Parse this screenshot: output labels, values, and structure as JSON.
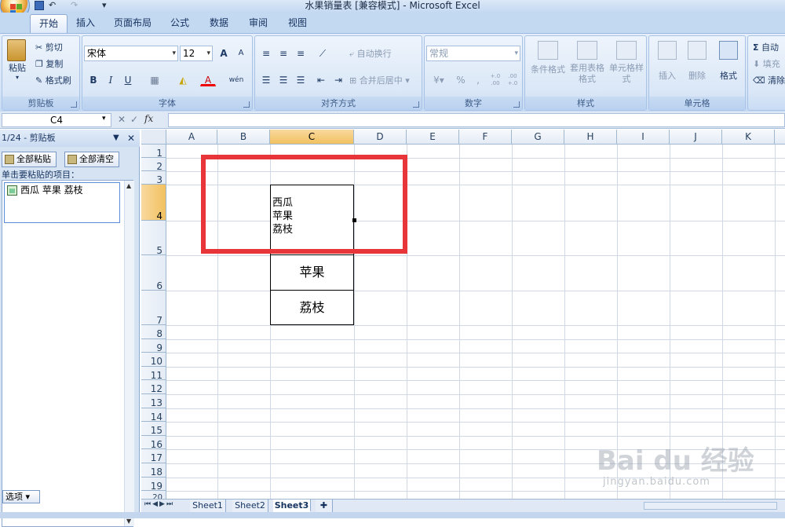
{
  "window": {
    "title": "水果销量表 [兼容模式] - Microsoft Excel"
  },
  "tabs": [
    "开始",
    "插入",
    "页面布局",
    "公式",
    "数据",
    "审阅",
    "视图"
  ],
  "ribbon": {
    "clipboard": {
      "label": "剪贴板",
      "paste": "粘贴",
      "cut": "剪切",
      "copy": "复制",
      "format_painter": "格式刷"
    },
    "font": {
      "label": "字体",
      "font_name": "宋体",
      "font_size": "12",
      "bold": "B",
      "italic": "I",
      "underline": "U",
      "grow": "A",
      "shrink": "A",
      "font_color": "A",
      "phonetic": "wén"
    },
    "alignment": {
      "label": "对齐方式",
      "wrap_text": "自动换行",
      "merge_center": "合并后居中"
    },
    "number": {
      "label": "数字",
      "format": "常规",
      "percent": "%",
      "comma": ",",
      "inc_decimal": "+.0 .00",
      "dec_decimal": ".00 +.0"
    },
    "styles": {
      "label": "样式",
      "conditional": "条件格式",
      "table": "套用表格格式",
      "cell_styles": "单元格样式"
    },
    "cells": {
      "label": "单元格",
      "insert": "插入",
      "delete": "删除",
      "format": "格式"
    },
    "editing": {
      "autosum": "自动",
      "fill": "填充",
      "clear": "清除"
    }
  },
  "formula_bar": {
    "name_box": "C4",
    "fx": "fx",
    "value": ""
  },
  "clipboard_pane": {
    "title": "1/24 - 剪贴板",
    "paste_all": "全部粘贴",
    "clear_all": "全部清空",
    "hint": "单击要粘贴的项目：",
    "item": "西瓜  苹果  荔枝",
    "options": "选项"
  },
  "grid": {
    "columns": [
      "A",
      "B",
      "C",
      "D",
      "E",
      "F",
      "G",
      "H",
      "I",
      "J",
      "K"
    ],
    "rows": [
      "1",
      "2",
      "3",
      "4",
      "5",
      "6",
      "7",
      "8",
      "9",
      "10",
      "11",
      "12",
      "13",
      "14",
      "15",
      "16",
      "17",
      "18",
      "19",
      "20"
    ],
    "selected_col": "C",
    "selected_row": "4",
    "cells": {
      "C4": [
        "西瓜",
        "苹果",
        "荔枝"
      ],
      "C6": "苹果",
      "C7": "荔枝"
    }
  },
  "sheets": [
    "Sheet1",
    "Sheet2",
    "Sheet3"
  ],
  "active_sheet": "Sheet3",
  "watermark": {
    "logo": "Bai du 经验",
    "url": "jingyan.baidu.com"
  },
  "colors": {
    "annotation_red": "#e8353a",
    "ribbon_blue": "#d5e4f6",
    "header_selected": "#f1c15f"
  }
}
